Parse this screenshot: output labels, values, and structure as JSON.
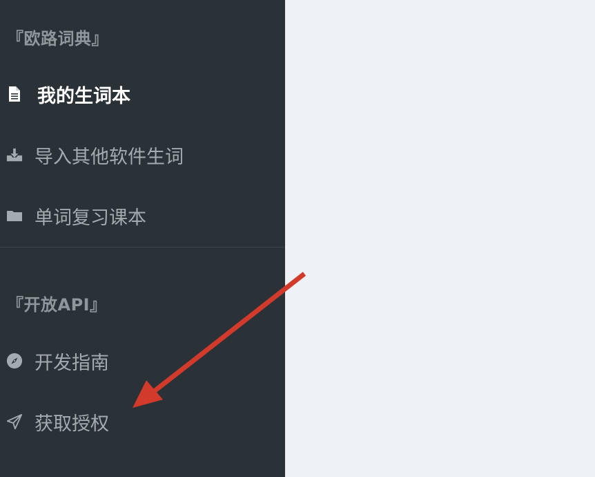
{
  "sidebar": {
    "sections": [
      {
        "title": "『欧路词典』",
        "items": [
          {
            "label": "我的生词本",
            "icon": "document-icon",
            "active": true
          },
          {
            "label": "导入其他软件生词",
            "icon": "download-tray-icon",
            "active": false
          },
          {
            "label": "单词复习课本",
            "icon": "folder-icon",
            "active": false
          }
        ]
      },
      {
        "title": "『开放API』",
        "items": [
          {
            "label": "开发指南",
            "icon": "compass-icon",
            "active": false
          },
          {
            "label": "获取授权",
            "icon": "paper-plane-icon",
            "active": false
          }
        ]
      }
    ]
  },
  "colors": {
    "sidebar_bg": "#2a3237",
    "content_bg": "#eef1f6",
    "active_text": "#ffffff",
    "inactive_text": "#a4abb0",
    "section_title": "#8f979c",
    "annotation_arrow": "#d23a2c"
  },
  "annotation": {
    "type": "arrow",
    "points_to": "获取授权"
  }
}
